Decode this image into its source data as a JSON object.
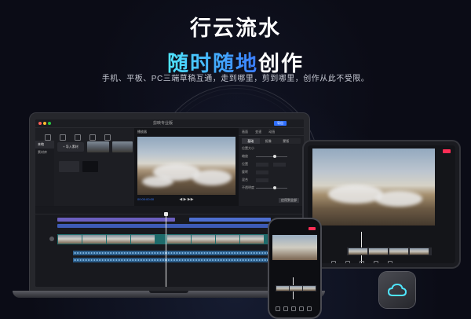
{
  "headline": {
    "line1": "行云流水",
    "line2_accent": "随时随地",
    "line2_plain": "创作",
    "subtitle": "手机、平板、PC三端草稿互通，走到哪里，剪到哪里，创作从此不受限。"
  },
  "laptop_app": {
    "window_title": "剪映专业版",
    "export_label": "导出",
    "import_label": "+ 导入素材",
    "sidebar_items": [
      "本地",
      "素材库"
    ],
    "preview_label": "播放器",
    "timecode": "00:00:00:00",
    "inspector_tabs": [
      "画面",
      "变速",
      "动画"
    ],
    "inspector_subtabs": [
      "基础",
      "抠像",
      "蒙版"
    ],
    "inspector_rows": [
      "位置大小",
      "缩放",
      "位置",
      "旋转",
      "混合",
      "不透明度"
    ],
    "apply_label": "应用到全部"
  },
  "colors": {
    "accent_start": "#4fe6ff",
    "accent_end": "#3a7bff",
    "background": "#0b0c16",
    "record_red": "#ff2d55"
  },
  "app_icon": {
    "name": "cloud-icon"
  }
}
